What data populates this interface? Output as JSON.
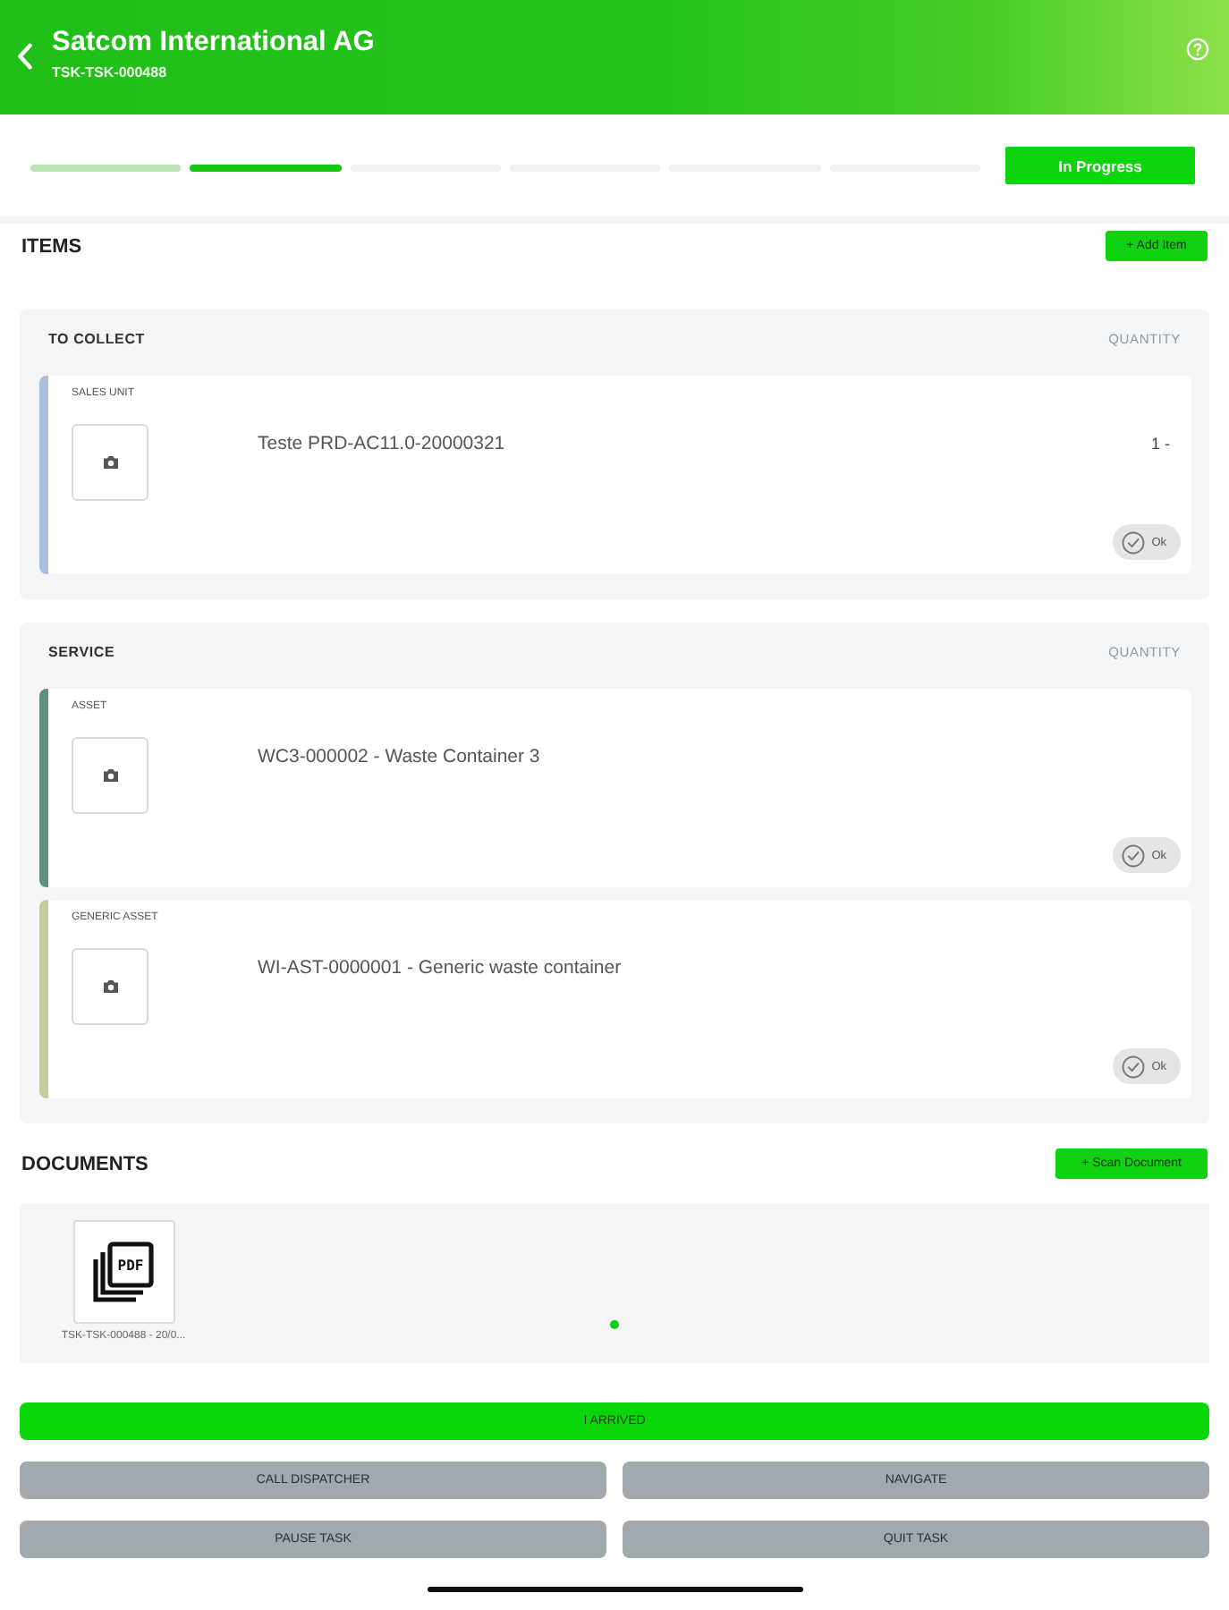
{
  "header": {
    "title": "Satcom International AG",
    "subtitle": "TSK-TSK-000488"
  },
  "progress": {
    "steps": [
      {
        "completed": true,
        "selected": false
      },
      {
        "completed": false,
        "selected": true
      },
      {
        "completed": false,
        "selected": false
      },
      {
        "completed": false,
        "selected": false
      },
      {
        "completed": false,
        "selected": false
      },
      {
        "completed": false,
        "selected": false
      }
    ],
    "status": "In Progress"
  },
  "items": {
    "title": "ITEMS",
    "add_button": "+ Add Item",
    "groups": [
      {
        "title": "TO COLLECT",
        "quantity_label": "QUANTITY",
        "entries": [
          {
            "type_label": "SALES UNIT",
            "name": "Teste PRD-AC11.0-20000321",
            "quantity": "1 -",
            "color": "#a9bddd",
            "ok_label": "Ok"
          }
        ]
      },
      {
        "title": "SERVICE",
        "quantity_label": "QUANTITY",
        "entries": [
          {
            "type_label": "ASSET",
            "name": "WC3-000002 - Waste Container 3",
            "color": "#5f8f7f",
            "ok_label": "Ok"
          },
          {
            "type_label": "GENERIC ASSET",
            "name": "WI-AST-0000001 - Generic waste container",
            "color": "#c5cc9f",
            "ok_label": "Ok"
          }
        ]
      }
    ]
  },
  "documents": {
    "title": "DOCUMENTS",
    "scan_button": "+ Scan Document",
    "files": [
      {
        "type": "PDF",
        "caption": "TSK-TSK-000488 - 20/0..."
      }
    ],
    "pager": [
      {
        "selected": true
      }
    ]
  },
  "actions": {
    "primary": "I ARRIVED",
    "buttons": [
      "CALL DISPATCHER",
      "NAVIGATE",
      "PAUSE TASK",
      "QUIT TASK"
    ]
  }
}
